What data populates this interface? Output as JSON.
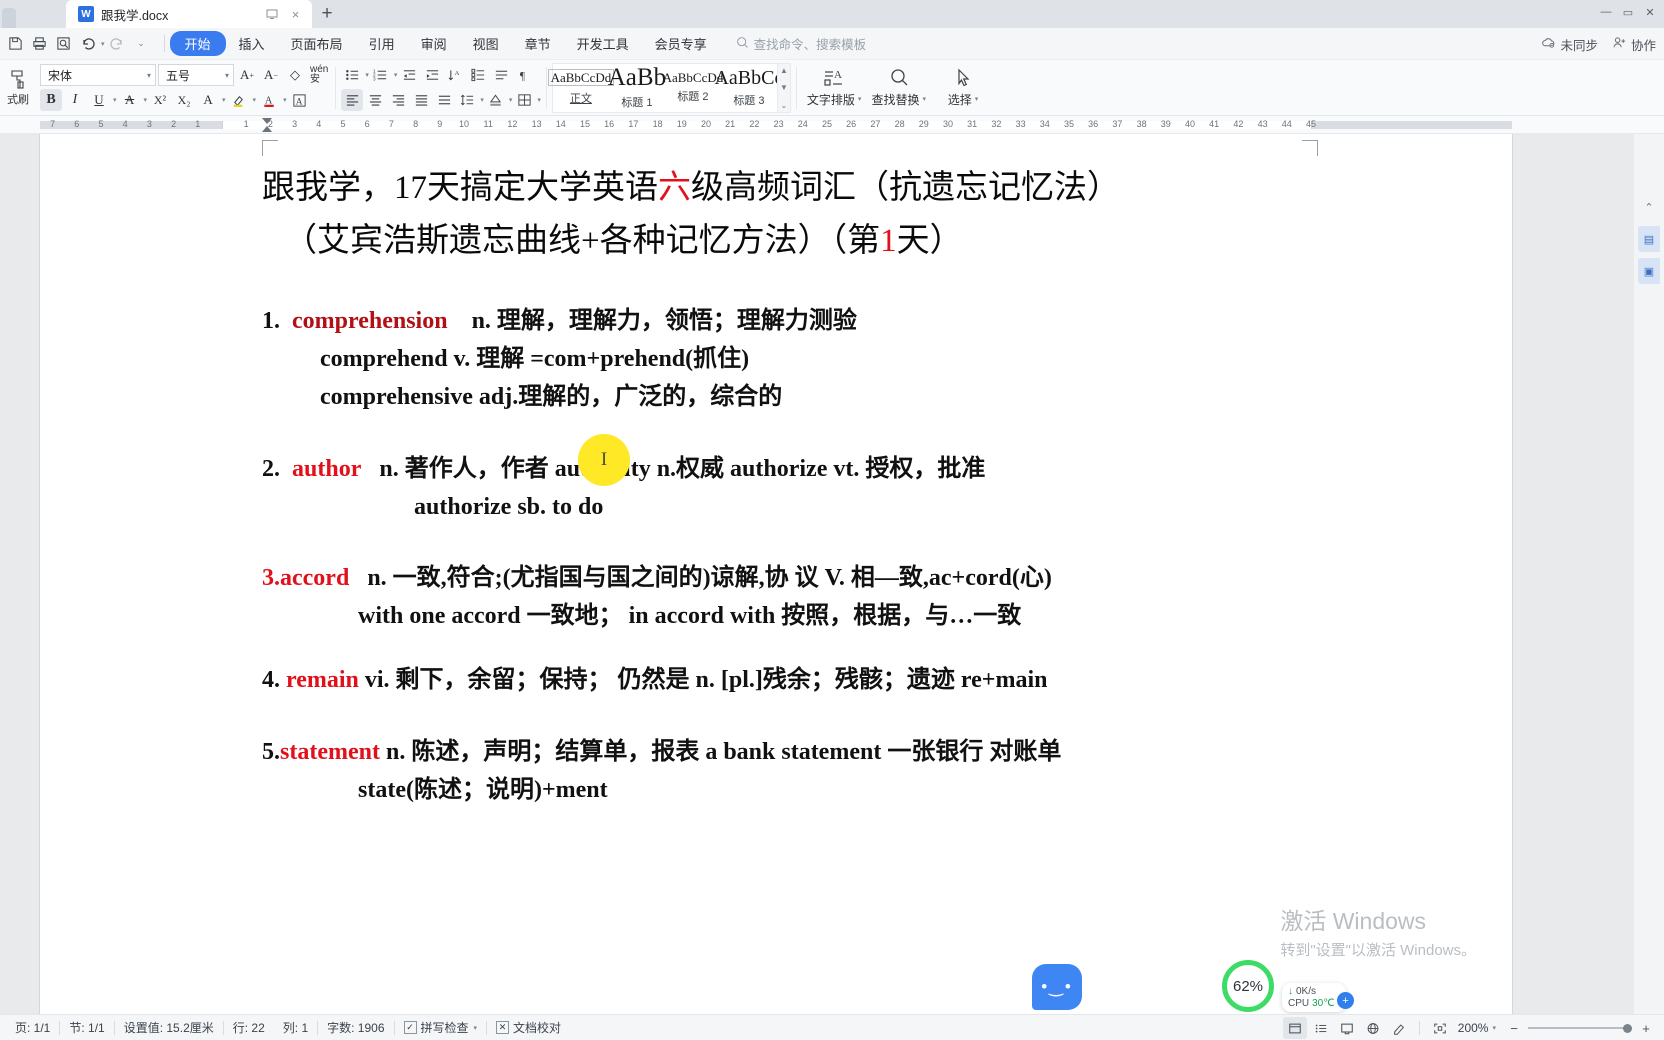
{
  "window": {
    "app": "WPS Writer",
    "doc_tab_title": "跟我学.docx",
    "doc_icon": "W",
    "new_tab_icon": "+",
    "tab_restore_icon": "restore-window-icon",
    "tab_close_icon": "×",
    "win_minimize": "—",
    "win_maximize": "▭",
    "win_close": "✕"
  },
  "quick_access": {
    "items": [
      {
        "name": "save-as-icon",
        "glyph": "⎘"
      },
      {
        "name": "print-icon",
        "glyph": "⎙"
      },
      {
        "name": "print-preview-icon",
        "glyph": "⧉"
      },
      {
        "name": "undo-icon",
        "glyph": "↺"
      },
      {
        "name": "redo-icon",
        "glyph": "↻"
      },
      {
        "name": "customize-qat-icon",
        "glyph": "⌄"
      }
    ]
  },
  "ribbon_tabs": [
    {
      "label": "开始",
      "active": true
    },
    {
      "label": "插入",
      "active": false
    },
    {
      "label": "页面布局",
      "active": false
    },
    {
      "label": "引用",
      "active": false
    },
    {
      "label": "审阅",
      "active": false
    },
    {
      "label": "视图",
      "active": false
    },
    {
      "label": "章节",
      "active": false
    },
    {
      "label": "开发工具",
      "active": false
    },
    {
      "label": "会员专享",
      "active": false
    }
  ],
  "search": {
    "placeholder": "查找命令、搜索模板",
    "icon": "search-icon"
  },
  "menu_right": {
    "sync_label": "未同步",
    "sync_icon": "cloud-icon",
    "collab_label": "协作",
    "collab_icon": "user-plus-icon"
  },
  "ribbon": {
    "format_painter_label": "式刷",
    "font_name": "宋体",
    "font_size": "五号",
    "font_buttons_row1": [
      {
        "name": "grow-font-icon",
        "glyph": "A⁺"
      },
      {
        "name": "shrink-font-icon",
        "glyph": "A⁻"
      },
      {
        "name": "clear-format-icon",
        "glyph": "◇"
      },
      {
        "name": "pinyin-guide-icon",
        "glyph": "wén"
      }
    ],
    "font_buttons_row2": [
      {
        "name": "bold-icon",
        "glyph": "B",
        "active": true
      },
      {
        "name": "italic-icon",
        "glyph": "I"
      },
      {
        "name": "underline-icon",
        "glyph": "U"
      },
      {
        "name": "text-border-icon",
        "glyph": "A"
      },
      {
        "name": "superscript-icon",
        "glyph": "X²"
      },
      {
        "name": "subscript-icon",
        "glyph": "X₂"
      },
      {
        "name": "text-effects-icon",
        "glyph": "A"
      },
      {
        "name": "highlight-color-icon",
        "glyph": "✎"
      },
      {
        "name": "font-color-icon",
        "glyph": "A"
      },
      {
        "name": "character-shading-icon",
        "glyph": "A"
      }
    ],
    "para_buttons_row1": [
      {
        "name": "bullet-list-icon",
        "glyph": "≔"
      },
      {
        "name": "numbered-list-icon",
        "glyph": "≕"
      },
      {
        "name": "decrease-indent-icon",
        "glyph": "⇤"
      },
      {
        "name": "increase-indent-icon",
        "glyph": "⇥"
      },
      {
        "name": "sort-icon",
        "glyph": "↕A"
      },
      {
        "name": "multilevel-list-icon",
        "glyph": "⊞"
      },
      {
        "name": "paragraph-layout-icon",
        "glyph": "⇄"
      },
      {
        "name": "show-marks-icon",
        "glyph": "¶"
      }
    ],
    "para_buttons_row2": [
      {
        "name": "align-left-icon",
        "glyph": "≡",
        "active": true
      },
      {
        "name": "align-center-icon",
        "glyph": "≡"
      },
      {
        "name": "align-right-icon",
        "glyph": "≡"
      },
      {
        "name": "justify-icon",
        "glyph": "≡"
      },
      {
        "name": "distribute-icon",
        "glyph": "≡"
      },
      {
        "name": "line-spacing-icon",
        "glyph": "↕≡"
      },
      {
        "name": "shading-icon",
        "glyph": "◰"
      },
      {
        "name": "borders-icon",
        "glyph": "⊞"
      }
    ],
    "styles": [
      {
        "preview": "AaBbCcDd",
        "name": "正文",
        "size": 13,
        "selected": true
      },
      {
        "preview": "AaBb",
        "name": "标题 1",
        "size": 25,
        "selected": false
      },
      {
        "preview": "AaBbCcDd",
        "name": "标题 2",
        "size": 13,
        "selected": false
      },
      {
        "preview": "AaBbCc",
        "name": "标题 3",
        "size": 20,
        "selected": false
      }
    ],
    "style_scroll": {
      "up": "▲",
      "down": "▼",
      "more": "⌄"
    },
    "text_layout": {
      "label": "文字排版",
      "icon": "text-layout-icon"
    },
    "find_replace": {
      "label": "查找替换",
      "icon": "search-icon"
    },
    "select": {
      "label": "选择",
      "icon": "cursor-arrow-icon"
    }
  },
  "ruler": {
    "left_numbers": [
      "7",
      "6",
      "5",
      "4",
      "3",
      "2",
      "1"
    ],
    "right_numbers": [
      "1",
      "2",
      "3",
      "4",
      "5",
      "6",
      "7",
      "8",
      "9",
      "10",
      "11",
      "12",
      "13",
      "14",
      "15",
      "16",
      "17",
      "18",
      "19",
      "20",
      "21",
      "22",
      "23",
      "24",
      "25",
      "26",
      "27",
      "28",
      "29",
      "30",
      "31",
      "32",
      "33",
      "34",
      "35",
      "36",
      "37",
      "38",
      "39",
      "40",
      "41",
      "42",
      "43",
      "44",
      "45"
    ]
  },
  "document": {
    "title_line1": {
      "p1": "跟我学，17天搞定大学英语",
      "red": "六",
      "p2": "级高频词汇（抗遗忘记忆法）"
    },
    "title_line2": {
      "p1": "（艾宾浩斯遗忘曲线+各种记忆方法）（第",
      "red": "1",
      "p2": "天）"
    },
    "entries": [
      {
        "number": "1.",
        "headword": "comprehension",
        "headword_color": "#b11016",
        "lines": [
          "n. 理解，理解力，领悟；理解力测验",
          "comprehend v.  理解  =com+prehend(抓住)",
          "comprehensive adj.理解的，广泛的，综合的"
        ]
      },
      {
        "number": "2.",
        "headword": "author",
        "headword_color": "#e2101a",
        "lines": [
          "n. 著作人，作者  authority n.权威  authorize vt.  授权，批准",
          "authorize sb. to do"
        ]
      },
      {
        "number": "3.",
        "headword": "accord",
        "headword_color": "#e2101a",
        "lines": [
          "n.  一致,符合;(尤指国与国之间的)谅解,协 议  V.   相—致,ac+cord(心)",
          "with one accord  一致地；  in accord with  按照，根据，与…一致"
        ]
      },
      {
        "number": "4.",
        "headword": "remain",
        "headword_color": "#e2101a",
        "lines": [
          "vi.  剩下，余留；保持；  仍然是 n. [pl.]残余；残骸；遗迹  re+main"
        ]
      },
      {
        "number": "5.",
        "headword": "statement",
        "headword_color": "#e2101a",
        "lines": [
          "n.  陈述，声明；结算单，报表  a bank statement  一张银行  对账单",
          "state(陈述；说明)+ment"
        ]
      }
    ]
  },
  "right_tools": [
    {
      "name": "scroll-up-icon",
      "glyph": "⌃"
    },
    {
      "name": "sidebar-panel-icon",
      "glyph": "▤"
    },
    {
      "name": "sidebar-doc-icon",
      "glyph": "▣"
    }
  ],
  "overlays": {
    "cursor_ibeam": "I",
    "chat_face": "•‿•",
    "watermark_line1": "激活 Windows",
    "watermark_line2": "转到\"设置\"以激活 Windows。",
    "cpu_speed": "0K/s",
    "cpu_label": "CPU",
    "cpu_temp": "30℃",
    "cpu_plus": "+",
    "ring_value": "62%"
  },
  "statusbar": {
    "items": [
      {
        "name": "page-count",
        "text": "页: 1/1"
      },
      {
        "name": "section-count",
        "text": "节: 1/1"
      },
      {
        "name": "setting-value",
        "text": "设置值: 15.2厘米"
      },
      {
        "name": "row-indicator",
        "text": "行: 22"
      },
      {
        "name": "column-indicator",
        "text": "列: 1"
      },
      {
        "name": "word-count",
        "text": "字数: 1906"
      }
    ],
    "spellcheck": {
      "label": "拼写检查",
      "icon": "check-box-icon",
      "caret": "▾"
    },
    "proofread": {
      "label": "文档校对",
      "icon": "x-box-icon"
    },
    "view_buttons": [
      {
        "name": "page-view-icon",
        "glyph": "▤",
        "active": true
      },
      {
        "name": "outline-view-icon",
        "glyph": "≔",
        "active": false
      },
      {
        "name": "reading-view-icon",
        "glyph": "⊡",
        "active": false
      },
      {
        "name": "web-view-icon",
        "glyph": "⊕",
        "active": false
      },
      {
        "name": "edit-view-icon",
        "glyph": "✎",
        "active": false
      }
    ],
    "fit_icon": "fit-page-icon",
    "zoom_level": "200%",
    "zoom_caret": "▾",
    "zoom_minus": "−",
    "zoom_plus": "+"
  },
  "colors": {
    "accent": "#3a7bf0",
    "red": "#e2101a",
    "dark_red": "#b11016",
    "chrome": "#f4f6f8",
    "tabbar": "#dfe3e8",
    "page_bg": "#e8eaec"
  }
}
